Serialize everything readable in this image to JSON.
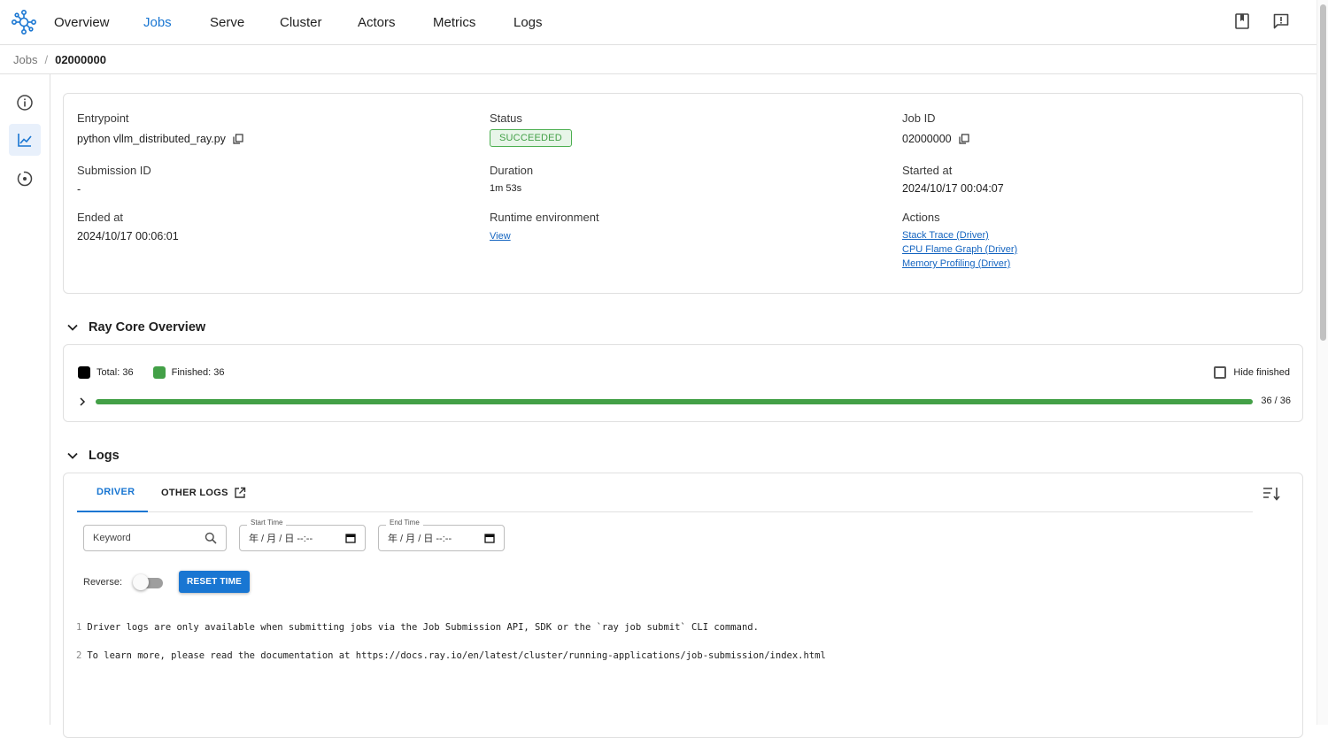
{
  "nav": {
    "items": [
      {
        "label": "Overview",
        "active": false
      },
      {
        "label": "Jobs",
        "active": true
      },
      {
        "label": "Serve",
        "active": false
      },
      {
        "label": "Cluster",
        "active": false
      },
      {
        "label": "Actors",
        "active": false
      },
      {
        "label": "Metrics",
        "active": false
      },
      {
        "label": "Logs",
        "active": false
      }
    ],
    "accent": "#1976d2"
  },
  "breadcrumb": {
    "parent": "Jobs",
    "separator": "/",
    "current": "02000000"
  },
  "job": {
    "entrypoint_label": "Entrypoint",
    "entrypoint": "python vllm_distributed_ray.py",
    "status_label": "Status",
    "status": "SUCCEEDED",
    "job_id_label": "Job ID",
    "job_id": "02000000",
    "submission_id_label": "Submission ID",
    "submission_id": "-",
    "duration_label": "Duration",
    "duration": "1m 53s",
    "started_label": "Started at",
    "started": "2024/10/17 00:04:07",
    "ended_label": "Ended at",
    "ended": "2024/10/17 00:06:01",
    "runtime_label": "Runtime environment",
    "runtime_link": "View",
    "actions_label": "Actions",
    "actions": [
      "Stack Trace (Driver)",
      "CPU Flame Graph (Driver)",
      "Memory Profiling (Driver)"
    ]
  },
  "core": {
    "title": "Ray Core Overview",
    "total_label": "Total: 36",
    "finished_label": "Finished: 36",
    "hide_finished": "Hide finished",
    "progress_fraction": 1.0,
    "progress_text": "36 / 36",
    "finished_color": "#43a047"
  },
  "logs": {
    "title": "Logs",
    "tab_driver": "DRIVER",
    "tab_other": "OTHER LOGS",
    "keyword_placeholder": "Keyword",
    "start_label": "Start Time",
    "start_value": "年 / 月 / 日 --:--",
    "end_label": "End Time",
    "end_value": "年 / 月 / 日 --:--",
    "reverse_label": "Reverse:",
    "reset_label": "RESET TIME",
    "lines": [
      {
        "n": "1",
        "text": "Driver logs are only available when submitting jobs via the Job Submission API, SDK or the `ray job submit` CLI command."
      },
      {
        "n": "2",
        "text": "To learn more, please read the documentation at https://docs.ray.io/en/latest/cluster/running-applications/job-submission/index.html"
      }
    ]
  }
}
